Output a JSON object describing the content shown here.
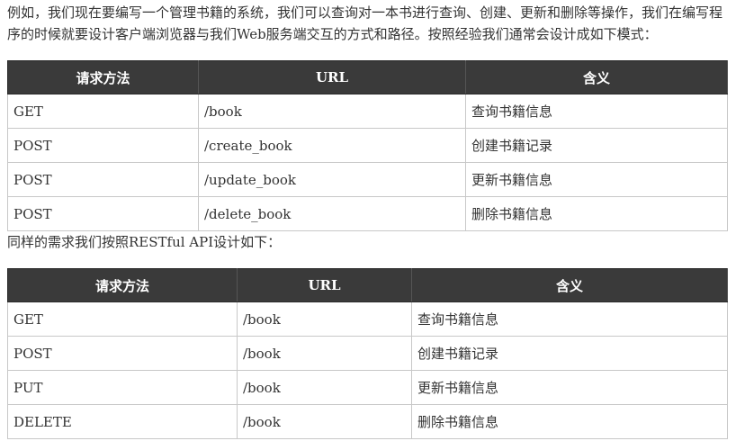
{
  "intro": "例如，我们现在要编写一个管理书籍的系统，我们可以查询对一本书进行查询、创建、更新和删除等操作，我们在编写程序的时候就要设计客户端浏览器与我们Web服务端交互的方式和路径。按照经验我们通常会设计成如下模式：",
  "table1": {
    "headers": [
      "请求方法",
      "URL",
      "含义"
    ],
    "rows": [
      [
        "GET",
        "/book",
        "查询书籍信息"
      ],
      [
        "POST",
        "/create_book",
        "创建书籍记录"
      ],
      [
        "POST",
        "/update_book",
        "更新书籍信息"
      ],
      [
        "POST",
        "/delete_book",
        "删除书籍信息"
      ]
    ]
  },
  "restful_intro": "同样的需求我们按照RESTful API设计如下：",
  "table2": {
    "headers": [
      "请求方法",
      "URL",
      "含义"
    ],
    "rows": [
      [
        "GET",
        "/book",
        "查询书籍信息"
      ],
      [
        "POST",
        "/book",
        "创建书籍记录"
      ],
      [
        "PUT",
        "/book",
        "更新书籍信息"
      ],
      [
        "DELETE",
        "/book",
        "删除书籍信息"
      ]
    ]
  }
}
